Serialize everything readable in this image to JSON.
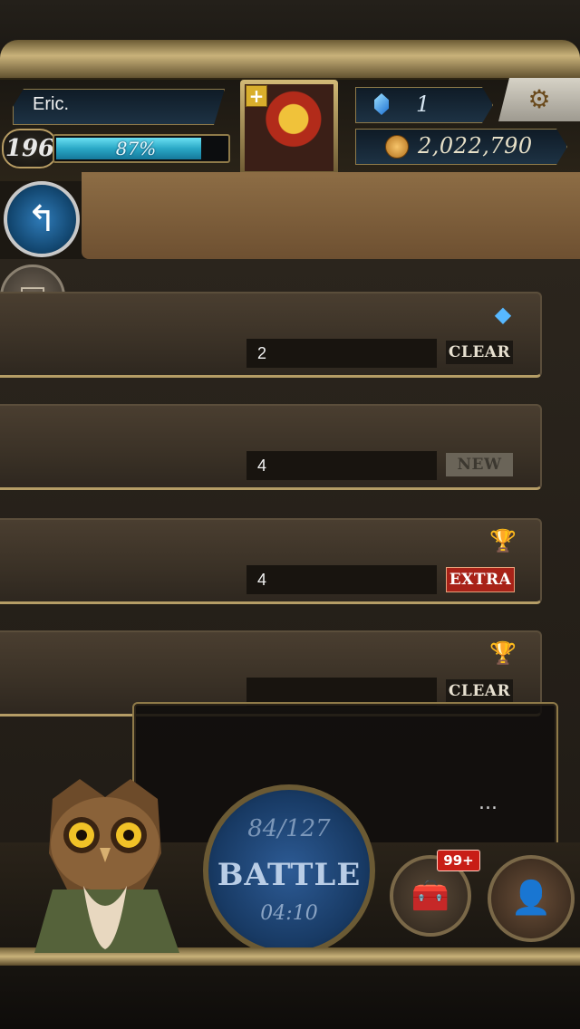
{
  "player": {
    "name": "Eric.",
    "level": "196",
    "exp_percent_text": "87%",
    "exp_fraction": 0.87
  },
  "currency": {
    "gems": "1",
    "gold": "2,022,790"
  },
  "icons": {
    "back": "back-arrow-icon",
    "menu": "list-icon",
    "settings": "gear-icon",
    "gem": "gem-icon",
    "coin": "coin-icon",
    "crystal": "crystal-icon",
    "trophy": "trophy-icon",
    "chest": "treasure-chest-icon",
    "friends": "friends-icon"
  },
  "quests": [
    {
      "count": "2",
      "status": "CLEAR",
      "status_type": "clear",
      "icon": "crystal"
    },
    {
      "count": "4",
      "status": "NEW",
      "status_type": "new",
      "icon": ""
    },
    {
      "count": "4",
      "status": "EXTRA",
      "status_type": "extra",
      "icon": "trophy"
    },
    {
      "count": "",
      "status": "CLEAR",
      "status_type": "clear",
      "icon": "trophy"
    }
  ],
  "popup": {
    "loading_text": "..."
  },
  "bottom_nav": {
    "battle_count": "84/127",
    "battle_label": "BATTLE",
    "battle_timer": "04:10",
    "chest_badge": "99+"
  },
  "colors": {
    "exp_bar": "#2aa8c6",
    "extra_badge": "#a82218",
    "frame_gold": "#b79c63",
    "battle_blue": "#183a64"
  }
}
